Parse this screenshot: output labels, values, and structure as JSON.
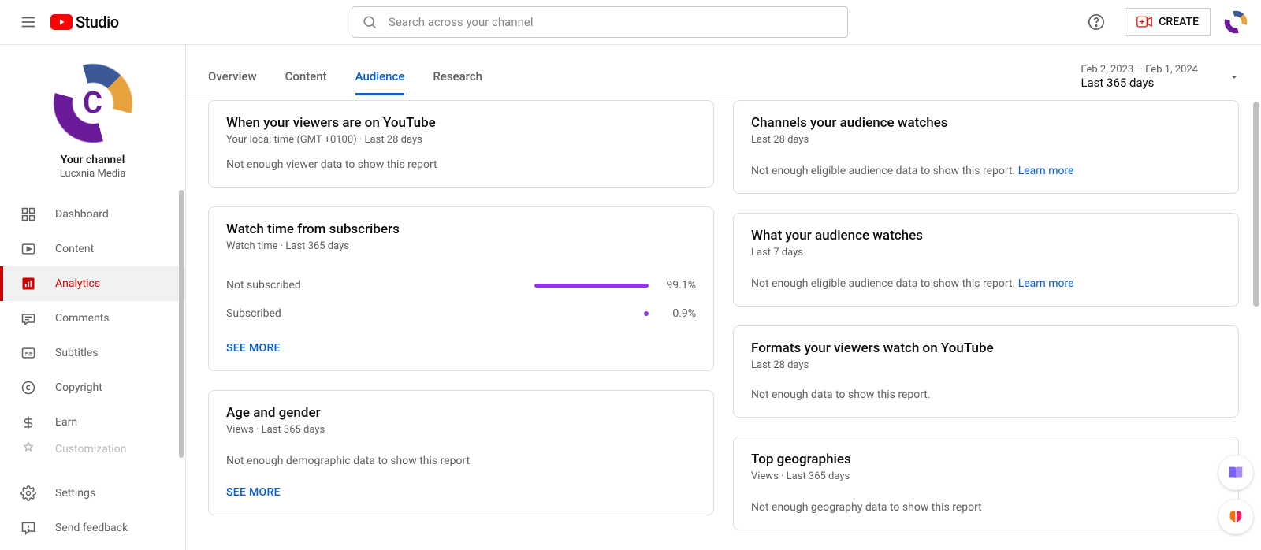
{
  "header": {
    "logo_text": "Studio",
    "search_placeholder": "Search across your channel",
    "create_label": "CREATE"
  },
  "sidebar": {
    "your_channel_label": "Your channel",
    "channel_name": "Lucxnia Media",
    "items": [
      {
        "label": "Dashboard"
      },
      {
        "label": "Content"
      },
      {
        "label": "Analytics"
      },
      {
        "label": "Comments"
      },
      {
        "label": "Subtitles"
      },
      {
        "label": "Copyright"
      },
      {
        "label": "Earn"
      },
      {
        "label": "Customization"
      }
    ],
    "settings_label": "Settings",
    "feedback_label": "Send feedback"
  },
  "tabs": {
    "items": [
      {
        "label": "Overview"
      },
      {
        "label": "Content"
      },
      {
        "label": "Audience"
      },
      {
        "label": "Research"
      }
    ],
    "date_line1": "Feb 2, 2023 – Feb 1, 2024",
    "date_line2": "Last 365 days"
  },
  "cards": {
    "viewers_on_youtube": {
      "title": "When your viewers are on YouTube",
      "sub": "Your local time (GMT +0100) · Last 28 days",
      "empty": "Not enough viewer data to show this report"
    },
    "channels_watched": {
      "title": "Channels your audience watches",
      "sub": "Last 28 days",
      "empty": "Not enough eligible audience data to show this report. ",
      "learn": "Learn more"
    },
    "watch_time_subs": {
      "title": "Watch time from subscribers",
      "sub": "Watch time · Last 365 days",
      "row1_label": "Not subscribed",
      "row1_val": "99.1%",
      "row2_label": "Subscribed",
      "row2_val": "0.9%",
      "see_more": "SEE MORE"
    },
    "what_watches": {
      "title": "What your audience watches",
      "sub": "Last 7 days",
      "empty": "Not enough eligible audience data to show this report. ",
      "learn": "Learn more"
    },
    "formats": {
      "title": "Formats your viewers watch on YouTube",
      "sub": "Last 28 days",
      "empty": "Not enough data to show this report."
    },
    "age_gender": {
      "title": "Age and gender",
      "sub": "Views · Last 365 days",
      "empty": "Not enough demographic data to show this report",
      "see_more": "SEE MORE"
    },
    "geographies": {
      "title": "Top geographies",
      "sub": "Views · Last 365 days",
      "empty": "Not enough geography data to show this report"
    }
  },
  "chart_data": {
    "type": "bar",
    "title": "Watch time from subscribers",
    "xlabel": "",
    "ylabel": "Watch time %",
    "ylim": [
      0,
      100
    ],
    "categories": [
      "Not subscribed",
      "Subscribed"
    ],
    "values": [
      99.1,
      0.9
    ]
  }
}
